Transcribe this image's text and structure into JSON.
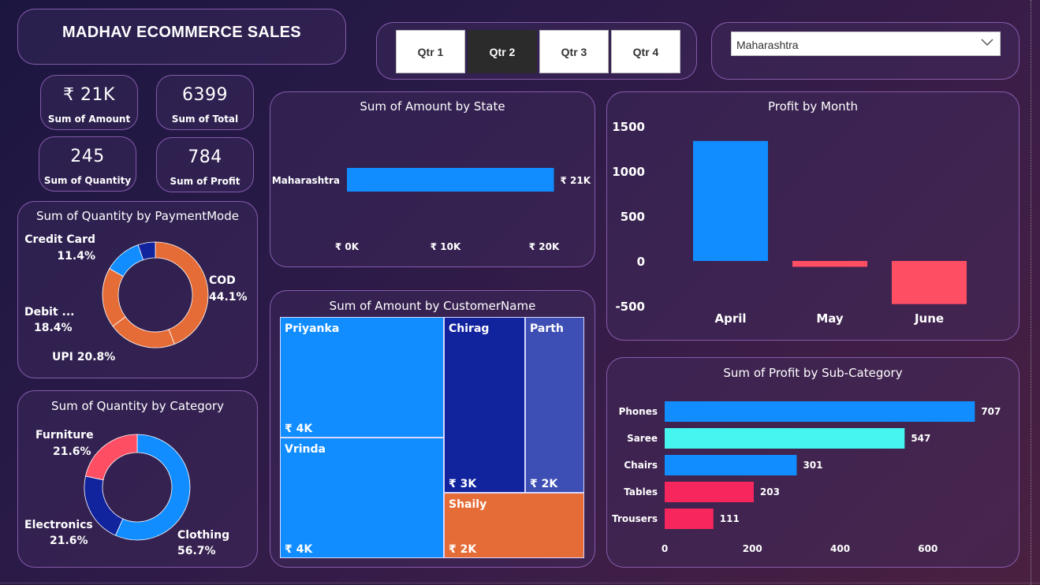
{
  "title": "MADHAV ECOMMERCE SALES",
  "quarters": [
    "Qtr 1",
    "Qtr 2",
    "Qtr 3",
    "Qtr 4"
  ],
  "active_quarter": "Qtr 2",
  "state_filter": {
    "selected": "Maharashtra"
  },
  "kpis": {
    "amount": {
      "value": "₹ 21K",
      "label": "Sum of Amount"
    },
    "total": {
      "value": "6399",
      "label": "Sum of Total"
    },
    "quantity": {
      "value": "245",
      "label": "Sum of Quantity"
    },
    "profit": {
      "value": "784",
      "label": "Sum of Profit"
    }
  },
  "colors": {
    "blue": "#118dff",
    "orange": "#e66c37",
    "navy": "#12239e",
    "red": "#fe4e64",
    "cyan": "#46f5f0",
    "pink": "#f7275e",
    "periwinkle": "#3d4eb4"
  },
  "chart_data": [
    {
      "id": "payment",
      "type": "donut",
      "title": "Sum of Quantity by PaymentMode",
      "slices": [
        {
          "label": "COD",
          "value": 44.1,
          "display": "44.1%",
          "color": "#e66c37"
        },
        {
          "label": "UPI",
          "value": 20.8,
          "display": "20.8%",
          "color": "#e66c37"
        },
        {
          "label": "Debit ...",
          "value": 18.4,
          "display": "18.4%",
          "color": "#e66c37"
        },
        {
          "label": "Credit Card",
          "value": 11.4,
          "display": "11.4%",
          "color": "#118dff"
        },
        {
          "label": "",
          "value": 5.3,
          "display": "",
          "color": "#12239e"
        }
      ]
    },
    {
      "id": "category",
      "type": "donut",
      "title": "Sum of Quantity by Category",
      "slices": [
        {
          "label": "Clothing",
          "value": 56.7,
          "display": "56.7%",
          "color": "#118dff"
        },
        {
          "label": "Electronics",
          "value": 21.6,
          "display": "21.6%",
          "color": "#12239e"
        },
        {
          "label": "Furniture",
          "value": 21.6,
          "display": "21.6%",
          "color": "#fe4e64"
        }
      ]
    },
    {
      "id": "state",
      "type": "bar",
      "orientation": "horizontal",
      "title": "Sum of Amount by State",
      "categories": [
        "Maharashtra"
      ],
      "values": [
        21000
      ],
      "data_labels": [
        "₹ 21K"
      ],
      "xlim": [
        0,
        22000
      ],
      "x_ticks": [
        0,
        10000,
        20000
      ],
      "x_tick_labels": [
        "₹ 0K",
        "₹ 10K",
        "₹ 20K"
      ]
    },
    {
      "id": "profit_month",
      "type": "bar",
      "title": "Profit by Month",
      "categories": [
        "April",
        "May",
        "June"
      ],
      "values": [
        1335,
        -65,
        -480
      ],
      "ylim": [
        -500,
        1500
      ],
      "y_ticks": [
        1500,
        1000,
        500,
        0,
        -500
      ],
      "y_tick_labels": [
        "1500",
        "1000",
        "500",
        "0",
        "-500"
      ]
    },
    {
      "id": "customer",
      "type": "treemap",
      "title": "Sum of Amount by CustomerName",
      "items": [
        {
          "name": "Priyanka",
          "label": "₹ 4K",
          "value": 4
        },
        {
          "name": "Vrinda",
          "label": "₹ 4K",
          "value": 4
        },
        {
          "name": "Chirag",
          "label": "₹ 3K",
          "value": 3
        },
        {
          "name": "Parth",
          "label": "₹ 2K",
          "value": 2
        },
        {
          "name": "Shaily",
          "label": "₹ 2K",
          "value": 2
        }
      ]
    },
    {
      "id": "subcategory",
      "type": "bar",
      "orientation": "horizontal",
      "title": "Sum of Profit by Sub-Category",
      "categories": [
        "Phones",
        "Saree",
        "Chairs",
        "Tables",
        "Trousers"
      ],
      "values": [
        707,
        547,
        301,
        203,
        111
      ],
      "xlim": [
        0,
        710
      ],
      "x_ticks": [
        0,
        200,
        400,
        600
      ],
      "x_tick_labels": [
        "0",
        "200",
        "400",
        "600"
      ]
    }
  ]
}
